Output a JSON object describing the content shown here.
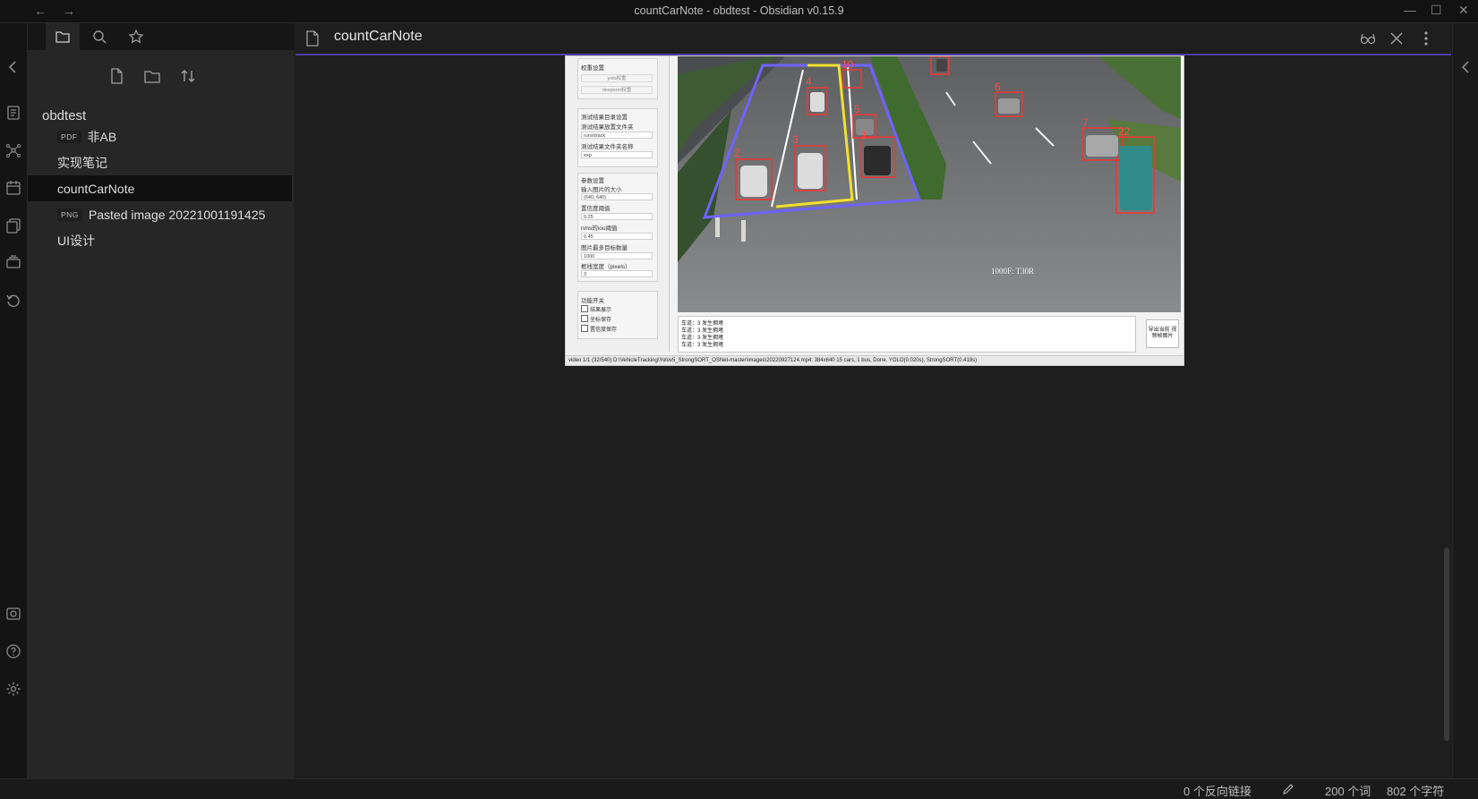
{
  "window": {
    "title": "countCarNote - obdtest - Obsidian v0.15.9",
    "back_icon": "←",
    "forward_icon": "→",
    "minimize_icon": "—",
    "maximize_icon": "☐",
    "close_icon": "✕"
  },
  "sidebar": {
    "vault_name": "obdtest",
    "files": [
      {
        "tag": "PDF",
        "name": "非AB"
      },
      {
        "tag": "",
        "name": "实现笔记"
      },
      {
        "tag": "",
        "name": "countCarNote"
      },
      {
        "tag": "PNG",
        "name": "Pasted image 20221001191425"
      },
      {
        "tag": "",
        "name": "UI设计"
      }
    ]
  },
  "view": {
    "title": "countCarNote"
  },
  "embedded_app": {
    "cfg": {
      "weights_title": "权重设置",
      "yolo_weight_btn": "yolo权重",
      "deepsort_weight_btn": "deepsort权重",
      "result_title": "测试结果目录设置",
      "result_dir_label": "测试结果放置文件夹",
      "result_dir_value": "runs\\track",
      "result_name_label": "测试结果文件夹名称",
      "result_name_value": "exp",
      "params_title": "参数设置",
      "img_size_label": "输入图片的大小",
      "img_size_value": "(640, 640)",
      "conf_label": "置信度阈值",
      "conf_value": "0.25",
      "iou_label": "nms的iou阈值",
      "iou_value": "0.45",
      "maxdet_label": "图片最多目标数量",
      "maxdet_value": "1000",
      "line_label": "框线宽度（pixels）",
      "line_value": "3",
      "func_title": "功能开关",
      "check1": "结果展示",
      "check2": "坐标保存",
      "check3": "置信度保存"
    },
    "log_lines": [
      "车道：3 发生拥堵",
      "车道：3 发生拥堵",
      "车道：3 发生拥堵",
      "车道：3 发生拥堵"
    ],
    "export_button": "导出当前 视频帧图片",
    "status": "video 1/1 (32/540) D:\\VehicleTracking\\Yolov5_StrongSORT_OSNet-master\\images\\20220927124.mp4: 384x640 15 cars, 1 bus, Done. YOLO(0.020s), StrongSORT(0.419s)",
    "video_overlay": "1000F: T30R",
    "box_labels": [
      "1",
      "2",
      "3",
      "4",
      "5",
      "6",
      "7",
      "10",
      "22"
    ]
  },
  "status_bar": {
    "backlinks": "0 个反向链接",
    "words": "200 个词",
    "chars": "802 个字符"
  },
  "colors": {
    "accent": "#4e3fa3",
    "lane_blue": "#6f63ff",
    "lane_yellow": "#f0e030",
    "box_red": "#e83a3a"
  }
}
